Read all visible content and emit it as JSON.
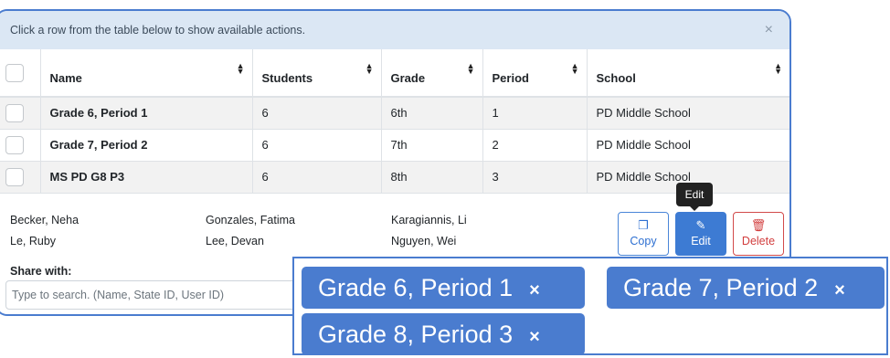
{
  "banner": {
    "text": "Click a row from the table below to show available actions.",
    "close_icon": "×"
  },
  "table": {
    "headers": [
      "Name",
      "Students",
      "Grade",
      "Period",
      "School"
    ],
    "sort_icon": "⬍",
    "rows": [
      {
        "name": "Grade 6, Period 1",
        "students": "6",
        "grade": "6th",
        "period": "1",
        "school": "PD Middle School"
      },
      {
        "name": "Grade 7, Period 2",
        "students": "6",
        "grade": "7th",
        "period": "2",
        "school": "PD Middle School"
      },
      {
        "name": "MS PD G8 P3",
        "students": "6",
        "grade": "8th",
        "period": "3",
        "school": "PD Middle School"
      }
    ]
  },
  "students": [
    "Becker, Neha",
    "Gonzales, Fatima",
    "Karagiannis, Li",
    "Le, Ruby",
    "Lee, Devan",
    "Nguyen, Wei"
  ],
  "share": {
    "label": "Share with:",
    "placeholder": "Type to search. (Name, State ID, User ID)"
  },
  "actions": {
    "copy": "Copy",
    "edit": "Edit",
    "delete": "Delete",
    "tooltip": "Edit"
  },
  "selected_tags": [
    "Grade 6, Period 1",
    "Grade 7, Period 2",
    "Grade 8, Period 3"
  ],
  "tag_remove_icon": "×",
  "colors": {
    "accent": "#4a7ccf",
    "banner_bg": "#dbe7f4",
    "delete": "#d23d3d"
  }
}
